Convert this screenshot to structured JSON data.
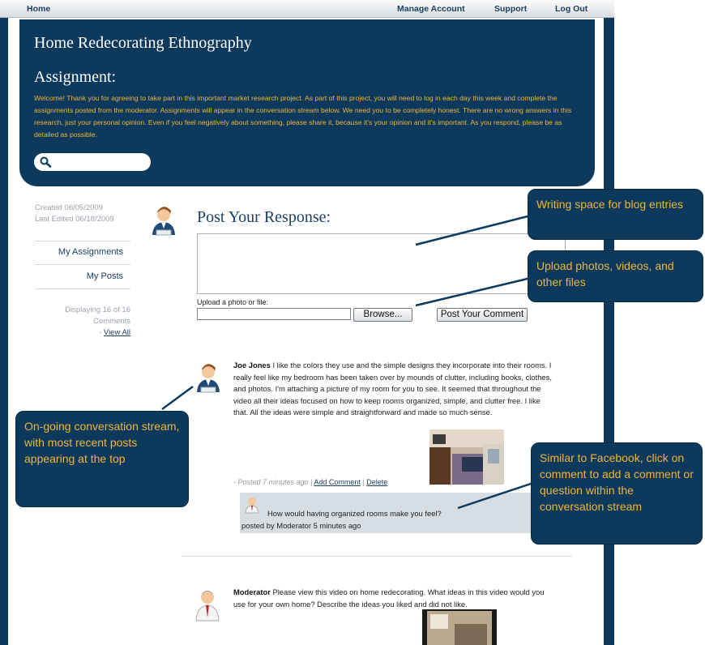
{
  "nav": {
    "home": "Home",
    "manage": "Manage Account",
    "support": "Support",
    "logout": "Log Out"
  },
  "header": {
    "title": "Home Redecorating Ethnography",
    "assignment_label": "Assignment:",
    "welcome": "Welcome! Thank you for agreeing to take part in this important market research project. As part of this project, you will need to log in each day this week and complete the assignments posted from the moderator. Assignments will appear in the conversation stream below. We need you to be completely honest. There are no wrong answers in this research, just your personal opinion. Even if you feel negatively about something, please share it, because it's your opinion and it's important. As you respond, please be as detailed as possible.",
    "search_icon": "search-icon"
  },
  "sidebar": {
    "created": "Created 06/05/2009",
    "edited": "Last Edited 06/18/2009",
    "my_assignments": "My Assignments",
    "my_posts": "My Posts",
    "displaying_1": "Displaying 16 of 16",
    "displaying_2": "Comments",
    "dash": "- ",
    "view_all": "View All"
  },
  "response": {
    "title": "Post Your Response:",
    "upload_label": "Upload a photo or file:",
    "browse": "Browse...",
    "post_comment": "Post Your Comment"
  },
  "posts": [
    {
      "author": "Joe Jones",
      "text": " I like the colors they use and the simple designs they incorporate into their rooms. I really feel like my bedroom has been taken over by mounds of clutter, including books, clothes, and photos. I'm attaching a picture of my room for you to see. It seemed that throughout the video all their ideas focused on how to keep rooms organized, simple, and clutter free. I like that. All the ideas were simple and straightforward and made so much sense.",
      "posted": "- Posted 7 minutes ago",
      "sep": " | ",
      "add_comment": "Add Comment",
      "delete": "Delete",
      "reply_text": "How would having organized rooms make you feel?",
      "reply_by": "posted by Moderator 5 minutes ago"
    },
    {
      "author": "Moderator",
      "text": " Please view this video on home redecorating. What ideas in this video would you use for your own home? Describe the ideas you liked and did not like."
    }
  ],
  "callouts": {
    "writing": "Writing space for blog entries",
    "upload": "Upload photos, videos, and other files",
    "stream": "On-going conversation stream, with most recent posts appearing at the top",
    "facebook": "Similar to Facebook, click on comment to add a comment or question within the conversation stream"
  },
  "colors": {
    "navy": "#0d3a5c",
    "gold": "#f0b43a",
    "link": "#1c3f63"
  }
}
